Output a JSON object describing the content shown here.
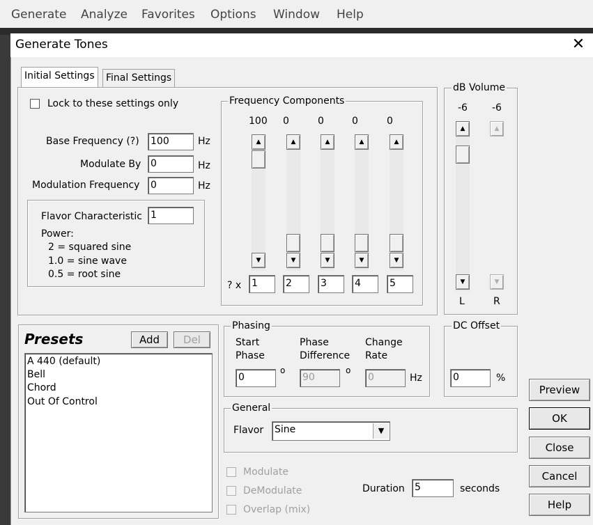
{
  "menubar": {
    "items": [
      "Generate",
      "Analyze",
      "Favorites",
      "Options",
      "Window",
      "Help"
    ]
  },
  "dialog": {
    "title": "Generate Tones"
  },
  "tabs": [
    "Initial Settings",
    "Final Settings"
  ],
  "initial": {
    "lock_label": "Lock to these settings only",
    "base_freq_label": "Base Frequency (?)",
    "base_freq_value": "100",
    "modulate_by_label": "Modulate By",
    "modulate_by_value": "0",
    "mod_freq_label": "Modulation Frequency",
    "mod_freq_value": "0",
    "hz": "Hz",
    "flavor_char_label": "Flavor Characteristic",
    "flavor_char_value": "1",
    "power_lines": [
      "Power:",
      "2 = squared sine",
      "1.0 = sine wave",
      "0.5 = root sine"
    ]
  },
  "freq_components": {
    "title": "Frequency Components",
    "levels": [
      "100",
      "0",
      "0",
      "0",
      "0"
    ],
    "multiplier_label": "? x",
    "multipliers": [
      "1",
      "2",
      "3",
      "4",
      "5"
    ]
  },
  "db_volume": {
    "title": "dB Volume",
    "left_value": "-6",
    "right_value": "-6",
    "left_label": "L",
    "right_label": "R"
  },
  "presets": {
    "title": "Presets",
    "add_label": "Add",
    "del_label": "Del",
    "items": [
      "A 440 (default)",
      "Bell",
      "Chord",
      "Out Of Control"
    ]
  },
  "phasing": {
    "title": "Phasing",
    "start_phase_label": [
      "Start",
      "Phase"
    ],
    "phase_diff_label": [
      "Phase",
      "Difference"
    ],
    "change_rate_label": [
      "Change",
      "Rate"
    ],
    "start_phase_value": "0",
    "phase_diff_value": "90",
    "change_rate_value": "0",
    "degree": "o",
    "hz": "Hz"
  },
  "dc_offset": {
    "title": "DC Offset",
    "value": "0",
    "unit": "%"
  },
  "general": {
    "title": "General",
    "flavor_label": "Flavor",
    "flavor_value": "Sine"
  },
  "options": {
    "modulate": "Modulate",
    "demodulate": "DeModulate",
    "overlap": "Overlap (mix)"
  },
  "duration": {
    "label": "Duration",
    "value": "5",
    "unit": "seconds"
  },
  "buttons": {
    "preview": "Preview",
    "ok": "OK",
    "close": "Close",
    "cancel": "Cancel",
    "help": "Help"
  }
}
